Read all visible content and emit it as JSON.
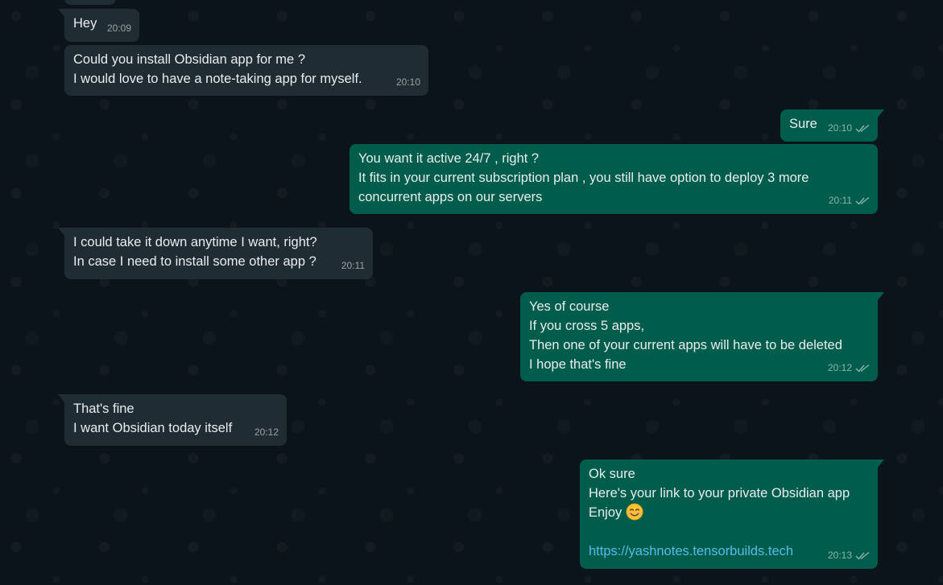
{
  "colors": {
    "background": "#0b141a",
    "incoming_bubble": "#202c33",
    "outgoing_bubble": "#005c4b",
    "text": "#e9edef",
    "link": "#53bdeb"
  },
  "messages": [
    {
      "direction": "in",
      "lines": [
        "Hey"
      ],
      "time": "20:09"
    },
    {
      "direction": "in",
      "lines": [
        "Could you install Obsidian app for me ?",
        "I would love to have a note-taking app for myself."
      ],
      "time": "20:10"
    },
    {
      "direction": "out",
      "lines": [
        "Sure"
      ],
      "time": "20:10",
      "status": "read-ticks-icon"
    },
    {
      "direction": "out",
      "lines": [
        "You want it active 24/7 , right ?",
        "It fits in your current subscription plan , you still have option to deploy 3 more",
        "concurrent apps on our servers"
      ],
      "time": "20:11",
      "status": "read-ticks-icon"
    },
    {
      "direction": "in",
      "lines": [
        "I could take it down anytime I want, right?",
        "In case I need to install some other app ?"
      ],
      "time": "20:11"
    },
    {
      "direction": "out",
      "lines": [
        "Yes of course",
        "If you cross 5 apps,",
        "Then one of your current apps will have to be deleted",
        "I hope that's fine"
      ],
      "time": "20:12",
      "status": "read-ticks-icon"
    },
    {
      "direction": "in",
      "lines": [
        "That's fine",
        "I want Obsidian today itself"
      ],
      "time": "20:12"
    },
    {
      "direction": "out",
      "lines": [
        "Ok sure",
        "Here's your link to your private Obsidian app",
        "Enjoy"
      ],
      "emoji": "smiling-face-icon",
      "link": "https://yashnotes.tensorbuilds.tech",
      "time": "20:13",
      "status": "read-ticks-icon"
    }
  ]
}
